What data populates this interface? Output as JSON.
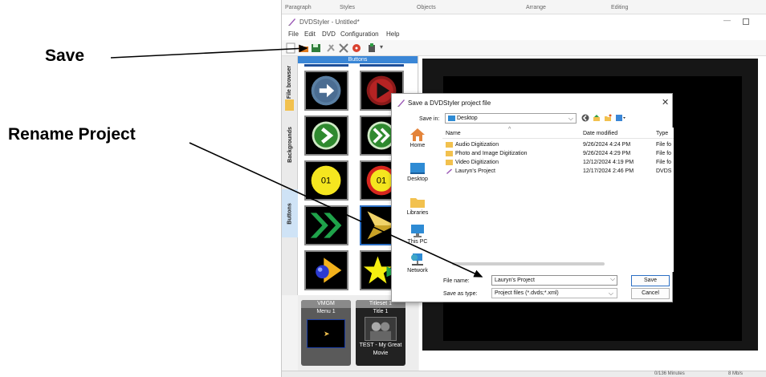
{
  "callouts": {
    "save": "Save",
    "rename": "Rename Project"
  },
  "app": {
    "ribbon": {
      "paragraph": "Paragraph",
      "styles": "Styles",
      "objects": "Objects",
      "arrange": "Arrange",
      "editing": "Editing"
    },
    "title": "DVDStyler - Untitled*",
    "menu": [
      "File",
      "Edit",
      "DVD",
      "Configuration",
      "Help"
    ],
    "side_tabs": [
      "File browser",
      "Backgrounds",
      "Buttons"
    ],
    "panel_header": "Buttons",
    "tray": {
      "vmgm": "VMGM",
      "menu1": "Menu 1",
      "titleset": "Titleset 1",
      "title1": "Title 1",
      "movie_caption_1": "TEST - My Great",
      "movie_caption_2": "Movie"
    },
    "status": {
      "minutes": "0/136 Minutes",
      "rate": "8 Mb/s"
    }
  },
  "dialog": {
    "title": "Save a DVDStyler project file",
    "save_in_label": "Save in:",
    "save_in_value": "Desktop",
    "places": [
      "Home",
      "Desktop",
      "Libraries",
      "This PC",
      "Network"
    ],
    "columns": {
      "name": "Name",
      "date": "Date modified",
      "type": "Type"
    },
    "files": [
      {
        "name": "Audio Digitization",
        "date": "9/26/2024 4:24 PM",
        "type": "File fo"
      },
      {
        "name": "Photo and Image Digitization",
        "date": "9/26/2024 4:29 PM",
        "type": "File fo"
      },
      {
        "name": "Video Digitization",
        "date": "12/12/2024 4:19 PM",
        "type": "File fo"
      },
      {
        "name": "Lauryn's Project",
        "date": "12/17/2024 2:46 PM",
        "type": "DVDS"
      }
    ],
    "file_name_label": "File name:",
    "file_name_value": "Lauryn's Project",
    "save_type_label": "Save as type:",
    "save_type_value": "Project files (*.dvds;*.xml)",
    "save_button": "Save",
    "cancel_button": "Cancel"
  },
  "colors": {
    "accent": "#3a86d6",
    "folder": "#f2c14e"
  }
}
